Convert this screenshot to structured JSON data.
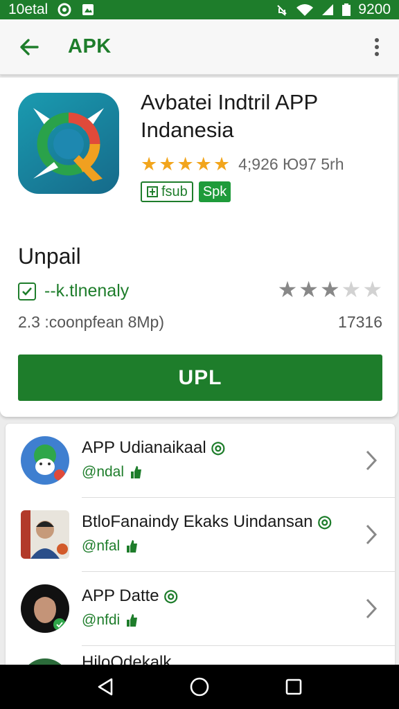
{
  "status_bar": {
    "left_text": "10etal",
    "time": "9200"
  },
  "app_bar": {
    "title": "APK"
  },
  "app": {
    "title": "Avbatei Indtril APP Indanesia",
    "rating_text": "4;926 Ю97 5rh",
    "badge_outline": "fsub",
    "badge_fill": "Spk",
    "rating_stars": 5
  },
  "detail": {
    "section_title": "Unpail",
    "check_label": "--k.tlnenaly",
    "size": "2.3 :coonpfean 8Mp)",
    "count": "17316",
    "user_rating_stars": 2.5
  },
  "install_button": "UPL",
  "list": [
    {
      "title": "APP Udianaikaal",
      "sub": "@ndal"
    },
    {
      "title": "BtloFanaindy Ekaks Uindansan",
      "sub": "@nfal"
    },
    {
      "title": "APP Datte",
      "sub": "@nfdi"
    },
    {
      "title": "HiloQdekalk",
      "sub": ""
    }
  ],
  "colors": {
    "accent": "#1e7d2b",
    "star": "#f2a51c",
    "app_bg": "#ececec"
  },
  "icons": [
    "back-arrow-icon",
    "overflow-menu-icon",
    "wifi-icon",
    "signal-icon",
    "battery-icon",
    "chevron-right-icon",
    "nav-back-icon",
    "nav-home-icon",
    "nav-recents-icon"
  ]
}
